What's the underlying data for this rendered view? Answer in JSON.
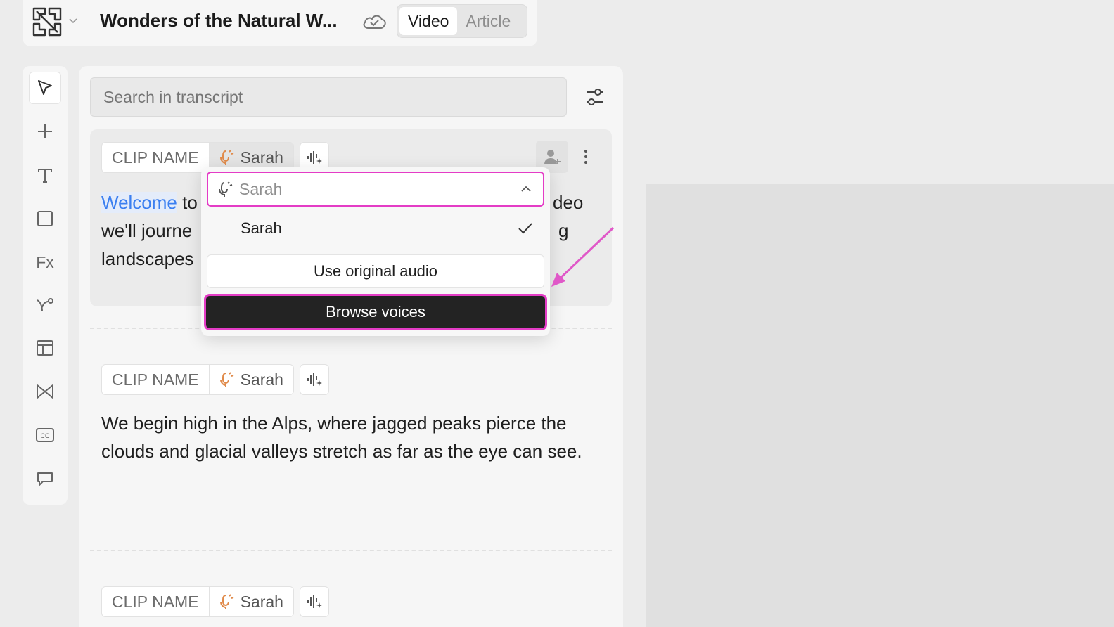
{
  "header": {
    "title": "Wonders of the Natural W...",
    "tabs": [
      {
        "label": "Video",
        "active": true
      },
      {
        "label": "Article",
        "active": false
      }
    ]
  },
  "transcript": {
    "search_placeholder": "Search in transcript",
    "clips": [
      {
        "name": "CLIP NAME",
        "voice": "Sarah",
        "highlight_word": "Welcome",
        "text_lines": [
          " to",
          "we'll journe",
          "landscapes"
        ],
        "text_tail_1": "deo",
        "text_tail_2": "g"
      },
      {
        "name": "CLIP NAME",
        "voice": "Sarah",
        "text": "We begin high in the Alps, where jagged peaks pierce the clouds and glacial valleys stretch as far as the eye can see."
      },
      {
        "name": "CLIP NAME",
        "voice": "Sarah"
      }
    ]
  },
  "voice_dropdown": {
    "current": "Sarah",
    "options": [
      {
        "label": "Sarah",
        "selected": true
      }
    ],
    "original_audio_label": "Use original audio",
    "browse_label": "Browse voices"
  },
  "colors": {
    "accent_pink": "#e43cc6",
    "highlight_blue": "#3b7ff0",
    "mic_orange": "#e08a4a"
  },
  "toolbar": {
    "tools": [
      "select-icon",
      "plus-icon",
      "text-icon",
      "rectangle-icon",
      "effects-icon",
      "path-icon",
      "layout-icon",
      "transition-icon",
      "captions-icon",
      "comment-icon"
    ],
    "effects_glyph": "Fx"
  }
}
